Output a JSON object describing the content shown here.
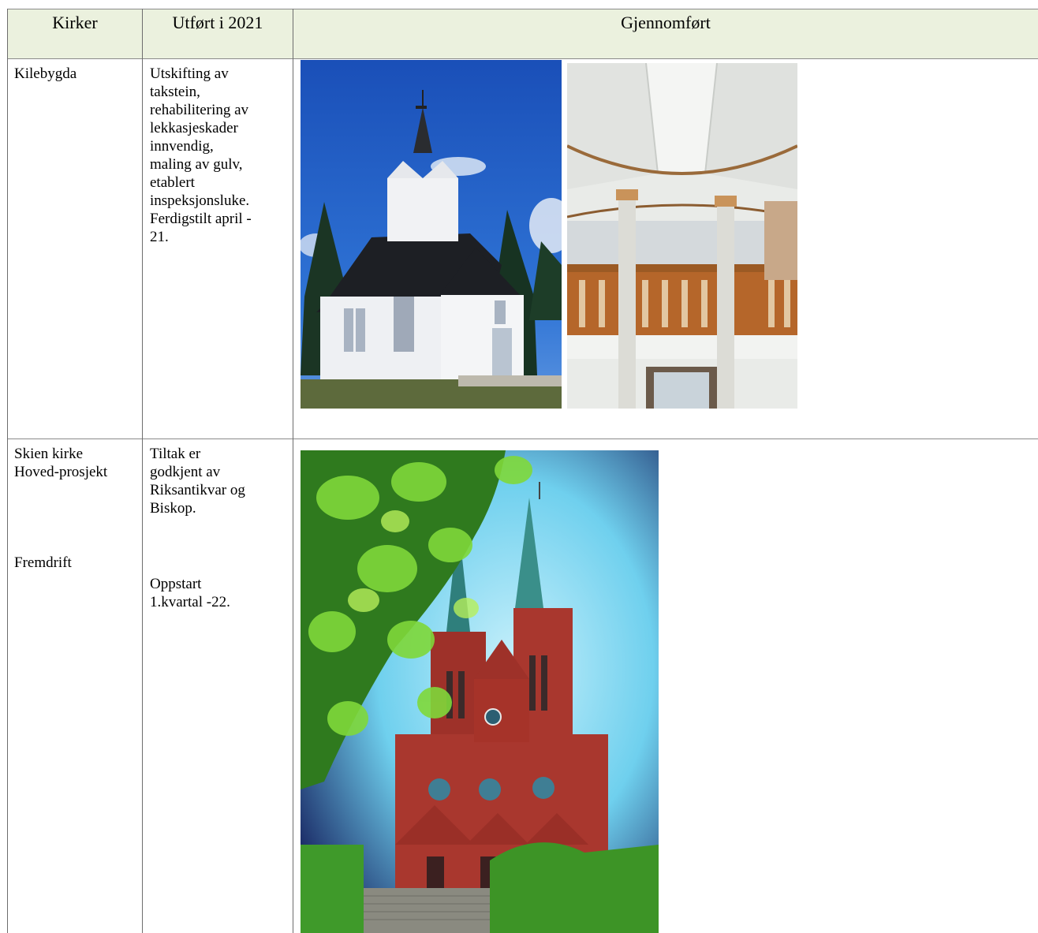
{
  "table": {
    "headers": [
      "Kirker",
      "Utført i 2021",
      "Gjennomført"
    ],
    "rows": [
      {
        "church": "Kilebygda",
        "work_lines": [
          "Utskifting av",
          "takstein,",
          "rehabilitering av",
          "lekkasjeskader",
          "innvendig,",
          "maling av gulv,",
          "etablert",
          "inspeksjonsluke.",
          "Ferdigstilt april -",
          "21."
        ]
      },
      {
        "church_lines": [
          "Skien kirke",
          "Hoved-prosjekt"
        ],
        "progress_label": "Fremdrift",
        "work_lines": [
          "Tiltak er",
          "godkjent av",
          "Riksantikvar og",
          "Biskop."
        ],
        "progress_lines": [
          "Oppstart",
          "1.kvartal -22."
        ]
      }
    ]
  },
  "images": [
    {
      "name": "kilebygda-church-exterior-photo",
      "colors": {
        "sky": "#1f5fc8",
        "walls": "#f2f3f5",
        "roof": "#1d1f24",
        "trees": "#1e3b26",
        "grass": "#5d6a3c"
      }
    },
    {
      "name": "kilebygda-church-interior-photo",
      "colors": {
        "ceiling": "#e9ebe8",
        "wood": "#b5662a",
        "pillar": "#dcdcd6",
        "trim": "#9a6a3a"
      }
    },
    {
      "name": "skien-church-photo",
      "colors": {
        "sky": "#6fd0ee",
        "brick": "#a9372e",
        "spire": "#3a8f8a",
        "leaves": "#5fbf2a",
        "hedge": "#3f9a2a"
      }
    }
  ]
}
